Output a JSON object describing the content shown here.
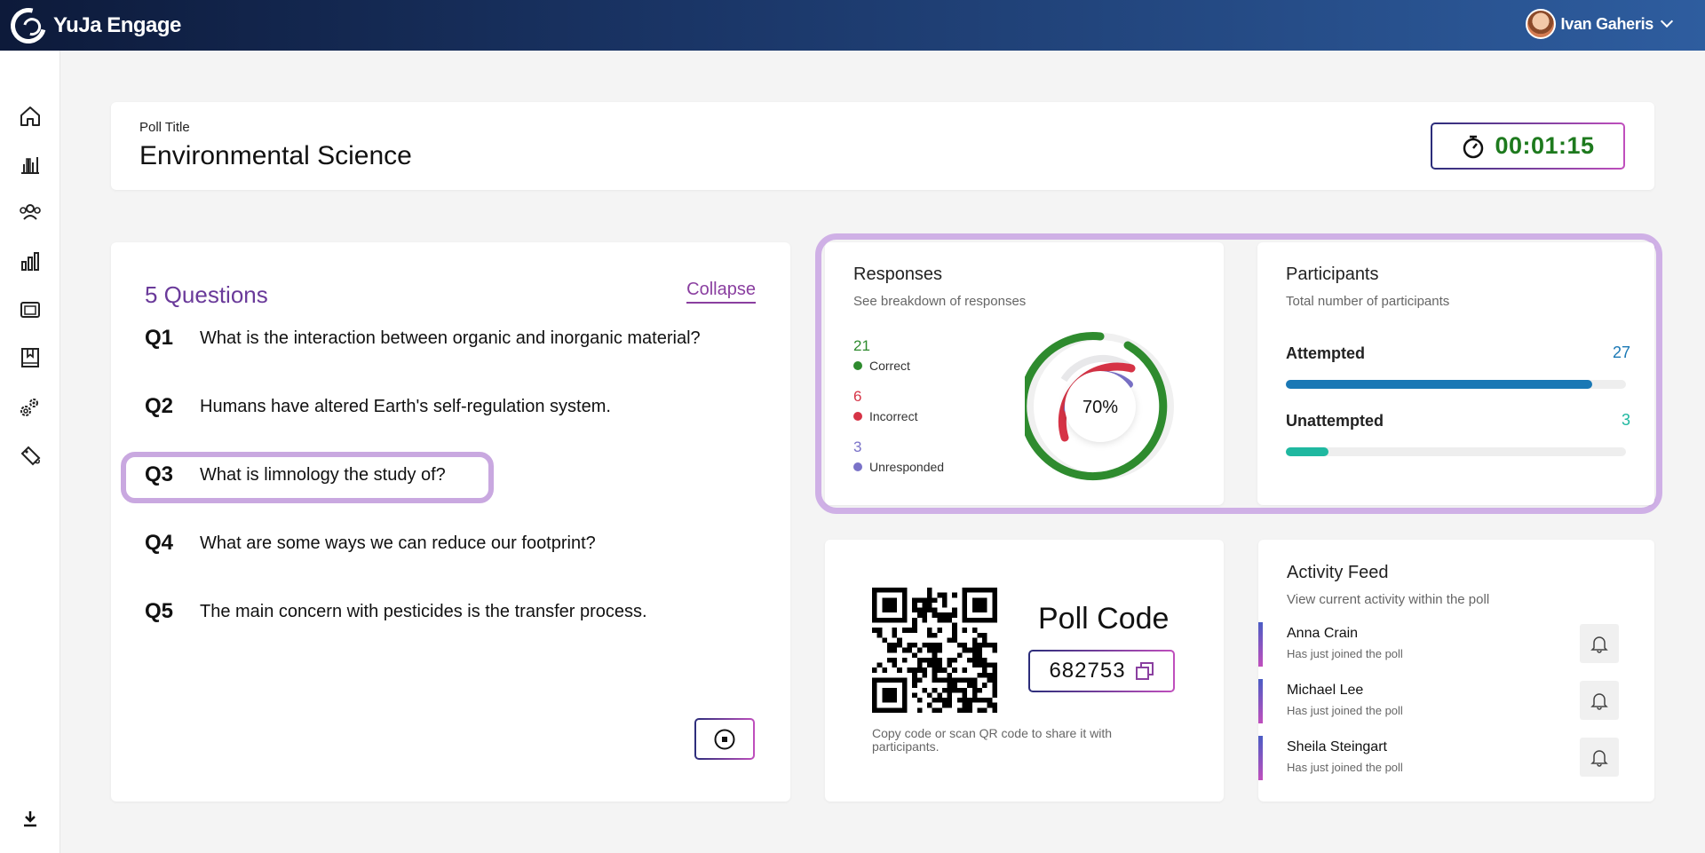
{
  "app": {
    "name": "YuJa Engage"
  },
  "user": {
    "name": "Ivan Gaheris"
  },
  "sidebar": {
    "items": [
      {
        "icon": "home-icon"
      },
      {
        "icon": "analytics-icon"
      },
      {
        "icon": "users-icon"
      },
      {
        "icon": "bar-chart-icon"
      },
      {
        "icon": "gallery-icon"
      },
      {
        "icon": "bookmark-book-icon"
      },
      {
        "icon": "settings-icon"
      },
      {
        "icon": "tag-icon"
      },
      {
        "icon": "download-icon"
      }
    ]
  },
  "poll": {
    "label": "Poll Title",
    "title": "Environmental Science",
    "timer": "00:01:15"
  },
  "questions": {
    "count_label": "5 Questions",
    "collapse_label": "Collapse",
    "items": [
      {
        "num": "Q1",
        "text": "What is the interaction between organic and inorganic material?"
      },
      {
        "num": "Q2",
        "text": "Humans have altered Earth's self-regulation system."
      },
      {
        "num": "Q3",
        "text": "What is limnology the study of?",
        "highlighted": true
      },
      {
        "num": "Q4",
        "text": "What are some ways we can reduce our footprint?"
      },
      {
        "num": "Q5",
        "text": "The main concern with pesticides is the transfer process."
      }
    ]
  },
  "responses": {
    "title": "Responses",
    "subtitle": "See breakdown of responses",
    "correct": {
      "count": "21",
      "label": "Correct",
      "color": "#2e8b2e"
    },
    "incorrect": {
      "count": "6",
      "label": "Incorrect",
      "color": "#d63346"
    },
    "unresponded": {
      "count": "3",
      "label": "Unresponded",
      "color": "#7a72c8"
    },
    "percent": "70%"
  },
  "participants": {
    "title": "Participants",
    "subtitle": "Total number of participants",
    "attempted": {
      "label": "Attempted",
      "value": "27",
      "fraction": 0.9,
      "color": "#1a78b5"
    },
    "unattempted": {
      "label": "Unattempted",
      "value": "3",
      "fraction": 0.125,
      "color": "#1fb8a0"
    }
  },
  "poll_code": {
    "title": "Poll Code",
    "code": "682753",
    "hint": "Copy code or scan QR code to share it with participants."
  },
  "activity": {
    "title": "Activity Feed",
    "subtitle": "View current activity within the poll",
    "items": [
      {
        "name": "Anna Crain",
        "status": "Has just joined the poll"
      },
      {
        "name": "Michael Lee",
        "status": "Has just joined the poll"
      },
      {
        "name": "Sheila Steingart",
        "status": "Has just joined the poll"
      }
    ]
  }
}
